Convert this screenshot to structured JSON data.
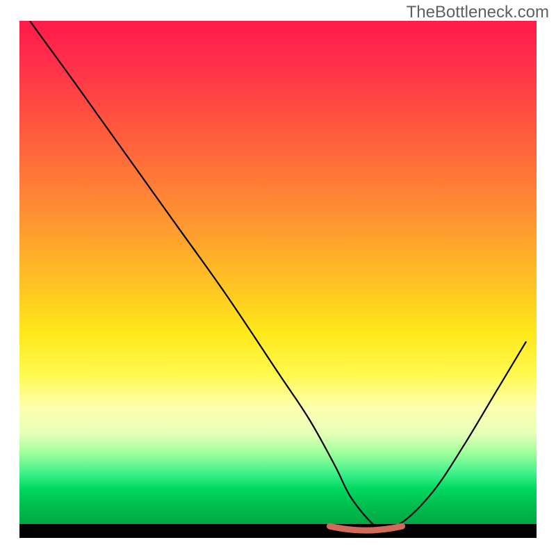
{
  "watermark": "TheBottleneck.com",
  "chart_data": {
    "type": "line",
    "title": "",
    "xlabel": "",
    "ylabel": "",
    "xlim": [
      0,
      100
    ],
    "ylim": [
      0,
      100
    ],
    "series": [
      {
        "name": "curve",
        "x": [
          2,
          10,
          20,
          30,
          40,
          50,
          56,
          61,
          64,
          68,
          70,
          74,
          80,
          86,
          92,
          98
        ],
        "y": [
          100,
          89,
          75,
          61,
          47,
          32,
          23,
          14,
          8,
          3,
          2,
          3,
          9,
          18,
          28,
          38
        ]
      }
    ],
    "valley_marker": {
      "name": "valley-band",
      "color": "#d06a5a",
      "x_start": 60,
      "x_end": 74,
      "y": 2
    },
    "background": {
      "gradient_top": "#ff1a4a",
      "gradient_mid": "#ffe81a",
      "gradient_bottom": "#00a843"
    }
  }
}
